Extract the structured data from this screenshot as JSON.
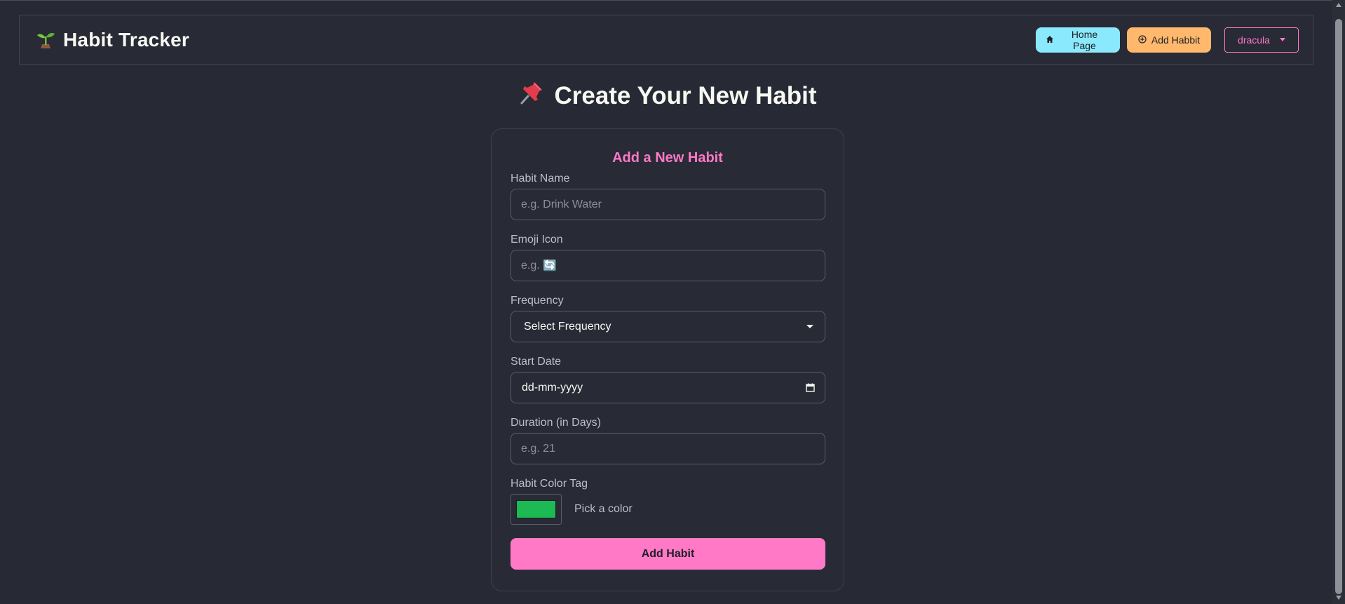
{
  "navbar": {
    "brand_title": "Habit Tracker",
    "brand_icon": "seedling-icon",
    "home_label": "Home Page",
    "add_label": "Add Habbit",
    "theme_value": "dracula"
  },
  "page": {
    "title": "Create Your New Habit",
    "title_icon": "pushpin-icon"
  },
  "form": {
    "card_title": "Add a New Habit",
    "habit_name": {
      "label": "Habit Name",
      "placeholder": "e.g. Drink Water"
    },
    "emoji_icon": {
      "label": "Emoji Icon",
      "placeholder": "e.g. 🔄"
    },
    "frequency": {
      "label": "Frequency",
      "value": "Select Frequency"
    },
    "start_date": {
      "label": "Start Date",
      "value": "dd-mm-yyyy"
    },
    "duration": {
      "label": "Duration (in Days)",
      "placeholder": "e.g. 21"
    },
    "color_tag": {
      "label": "Habit Color Tag",
      "hint": "Pick a color",
      "value": "#1db954"
    },
    "submit_label": "Add Habit"
  },
  "colors": {
    "background": "#272935",
    "accent_pink": "#ff79c6",
    "accent_cyan": "#8be9fd",
    "accent_orange": "#ffb86c"
  }
}
